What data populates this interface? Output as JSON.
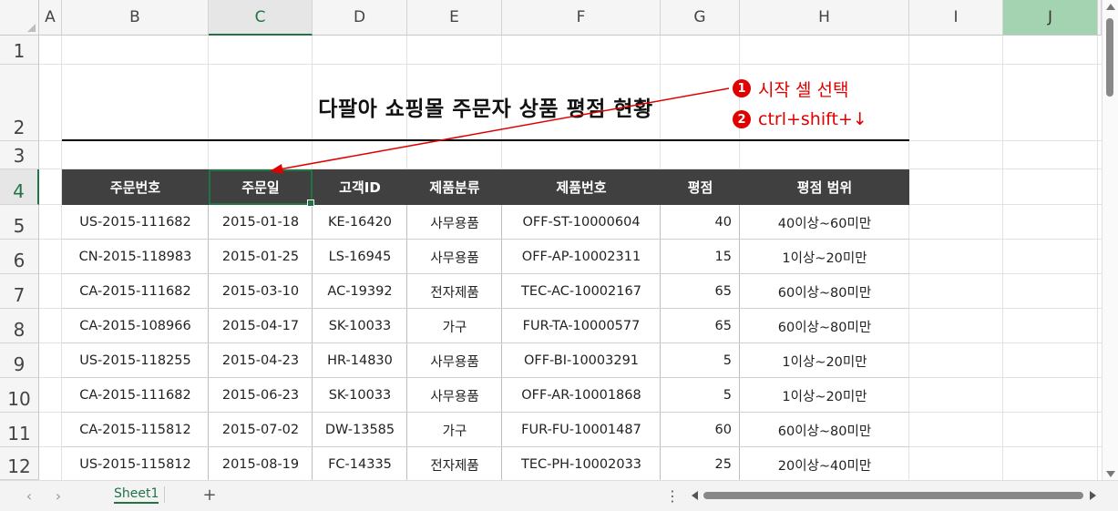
{
  "columns": [
    "A",
    "B",
    "C",
    "D",
    "E",
    "F",
    "G",
    "H",
    "I",
    "J"
  ],
  "rows": [
    "1",
    "2",
    "3",
    "4",
    "5",
    "6",
    "7",
    "8",
    "9",
    "10",
    "11",
    "12"
  ],
  "title": "다팔아 쇼핑몰 주문자 상품 평점 현황",
  "annotations": [
    {
      "badge": "1",
      "text": "시작 셀 선택"
    },
    {
      "badge": "2",
      "text": "ctrl+shift+↓"
    }
  ],
  "table": {
    "headers": [
      "주문번호",
      "주문일",
      "고객ID",
      "제품분류",
      "제품번호",
      "평점",
      "평점 범위"
    ],
    "rows": [
      [
        "US-2015-111682",
        "2015-01-18",
        "KE-16420",
        "사무용품",
        "OFF-ST-10000604",
        "40",
        "40이상~60미만"
      ],
      [
        "CN-2015-118983",
        "2015-01-25",
        "LS-16945",
        "사무용품",
        "OFF-AP-10002311",
        "15",
        "1이상~20미만"
      ],
      [
        "CA-2015-111682",
        "2015-03-10",
        "AC-19392",
        "전자제품",
        "TEC-AC-10002167",
        "65",
        "60이상~80미만"
      ],
      [
        "CA-2015-108966",
        "2015-04-17",
        "SK-10033",
        "가구",
        "FUR-TA-10000577",
        "65",
        "60이상~80미만"
      ],
      [
        "US-2015-118255",
        "2015-04-23",
        "HR-14830",
        "사무용품",
        "OFF-BI-10003291",
        "5",
        "1이상~20미만"
      ],
      [
        "CA-2015-111682",
        "2015-06-23",
        "SK-10033",
        "사무용품",
        "OFF-AR-10001868",
        "5",
        "1이상~20미만"
      ],
      [
        "CA-2015-115812",
        "2015-07-02",
        "DW-13585",
        "가구",
        "FUR-FU-10001487",
        "60",
        "60이상~80미만"
      ],
      [
        "US-2015-115812",
        "2015-08-19",
        "FC-14335",
        "전자제품",
        "TEC-PH-10002033",
        "25",
        "20이상~40미만"
      ]
    ]
  },
  "sheet_tab": "Sheet1",
  "icons": {
    "prev_sheet": "chevron-left-icon",
    "next_sheet": "chevron-right-icon",
    "add_sheet": "plus-icon",
    "more": "vertical-ellipsis-icon"
  },
  "colors": {
    "accent": "#217346",
    "annotation": "#e00000",
    "table_header_bg": "#404040",
    "selected_column_bg": "#a3d3b0"
  }
}
